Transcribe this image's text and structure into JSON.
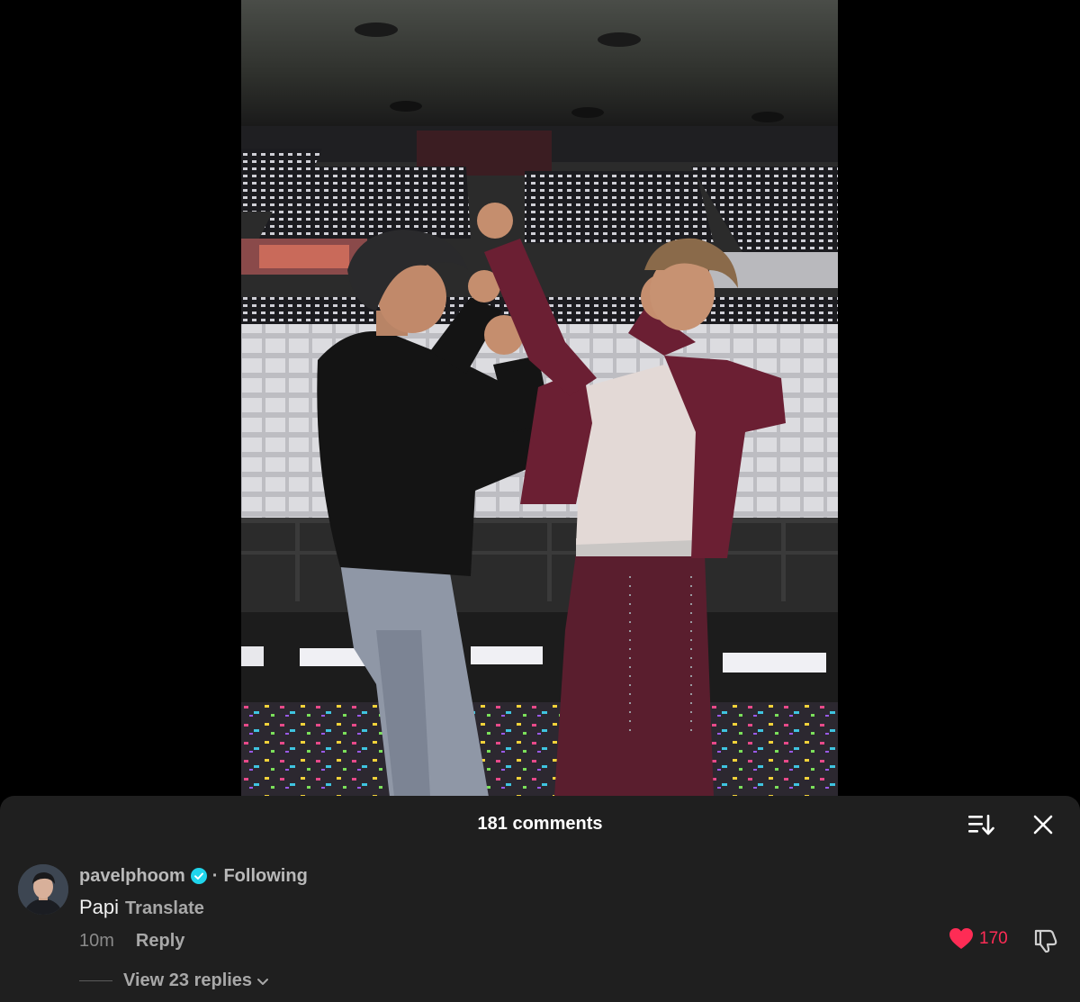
{
  "video": {
    "description_icon": "video-frame"
  },
  "comments_panel": {
    "title": "181 comments",
    "sort_icon": "sort-icon",
    "close_icon": "close-icon"
  },
  "comment": {
    "username": "pavelphoom",
    "verified": true,
    "separator": "·",
    "relationship": "Following",
    "text": "Papi",
    "translate_label": "Translate",
    "time": "10m",
    "reply_label": "Reply",
    "like_count": "170",
    "liked": true,
    "replies_label": "View 23 replies"
  },
  "colors": {
    "sheet_background": "#1f1f1f",
    "like_red": "#fe2c55",
    "verified_blue": "#20d5ec"
  }
}
